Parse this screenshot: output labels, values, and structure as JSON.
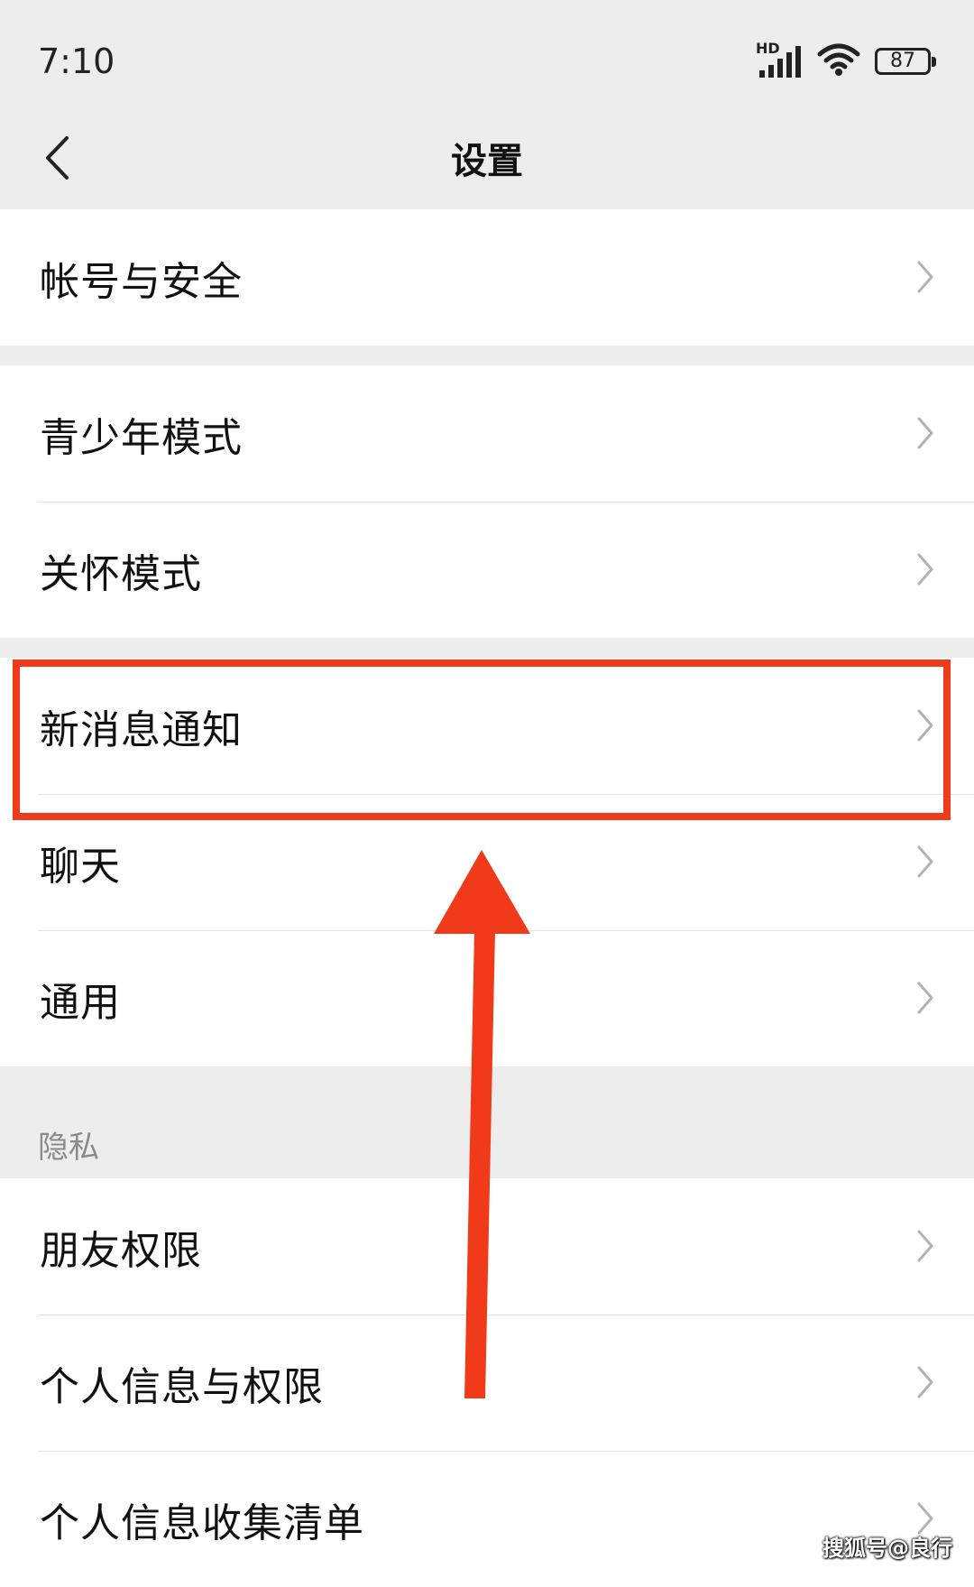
{
  "status_bar": {
    "time": "7:10",
    "network": "HD",
    "battery": "87",
    "icons": [
      "signal-icon",
      "wifi-icon",
      "battery-icon"
    ]
  },
  "header": {
    "title": "设置",
    "back_icon": "chevron-left-icon"
  },
  "groups": [
    {
      "items": [
        {
          "label": "帐号与安全"
        }
      ]
    },
    {
      "items": [
        {
          "label": "青少年模式"
        },
        {
          "label": "关怀模式"
        }
      ]
    },
    {
      "items": [
        {
          "label": "新消息通知"
        },
        {
          "label": "聊天"
        },
        {
          "label": "通用"
        }
      ]
    },
    {
      "header": "隐私",
      "items": [
        {
          "label": "朋友权限"
        },
        {
          "label": "个人信息与权限"
        },
        {
          "label": "个人信息收集清单"
        }
      ]
    }
  ],
  "annotation": {
    "highlight_color": "#f03a1a",
    "highlighted_item": "新消息通知"
  },
  "watermark": "搜狐号@良行",
  "colors": {
    "background": "#ededed",
    "card": "#ffffff",
    "text": "#111111",
    "muted": "#8a8a8a",
    "chevron": "#b2b2b2"
  }
}
